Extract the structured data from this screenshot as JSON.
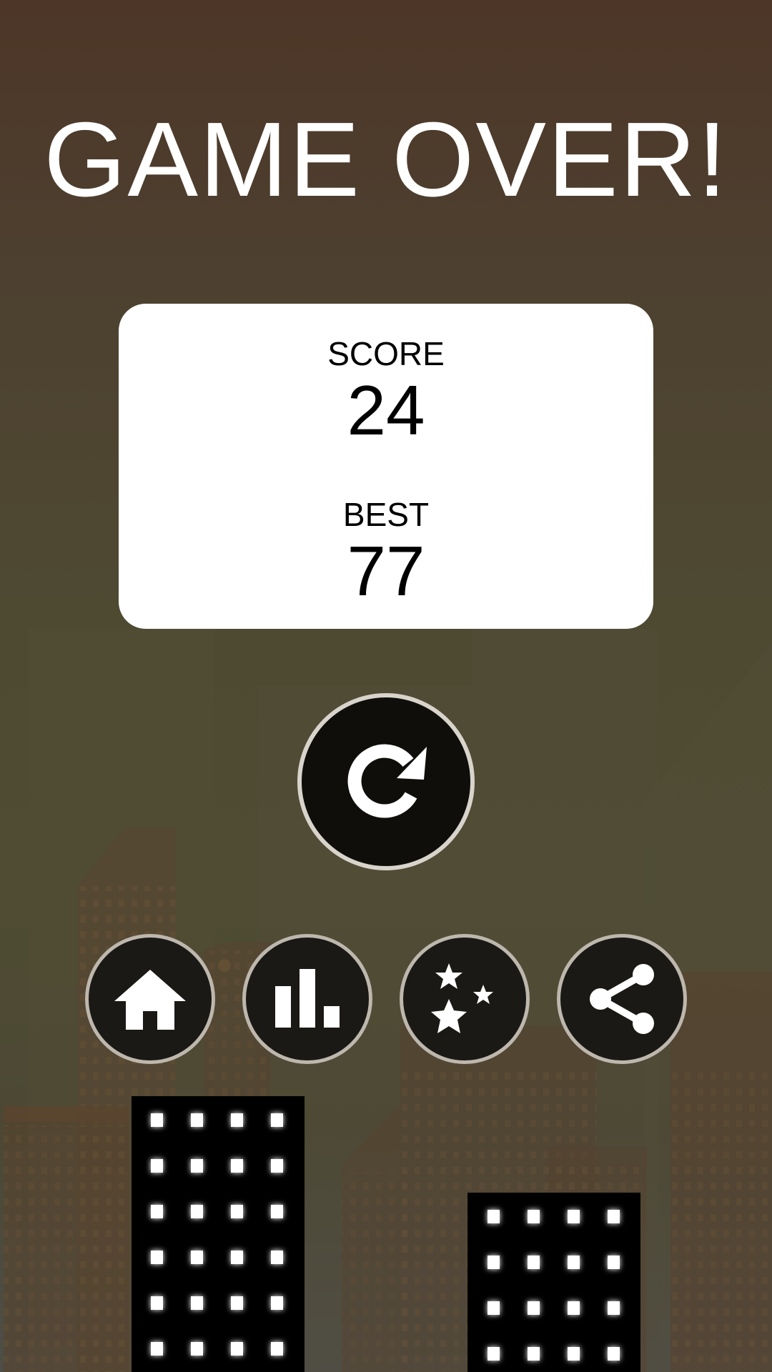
{
  "screen": {
    "title": "GAME OVER!"
  },
  "score_card": {
    "score_label": "SCORE",
    "score_value": "24",
    "best_label": "BEST",
    "best_value": "77"
  },
  "buttons": {
    "restart": {
      "icon": "restart-icon"
    },
    "home": {
      "icon": "home-icon"
    },
    "leaderboard": {
      "icon": "leaderboard-icon"
    },
    "rate": {
      "icon": "stars-icon"
    },
    "share": {
      "icon": "share-icon"
    }
  },
  "colors": {
    "background_top": "#4d3627",
    "background_mid": "#4e4a32",
    "background_bottom": "#4e4e48",
    "card": "#ffffff",
    "button_fill": "#0f0e0b",
    "button_ring": "#d8d4cc",
    "window_light": "#ffffff"
  }
}
